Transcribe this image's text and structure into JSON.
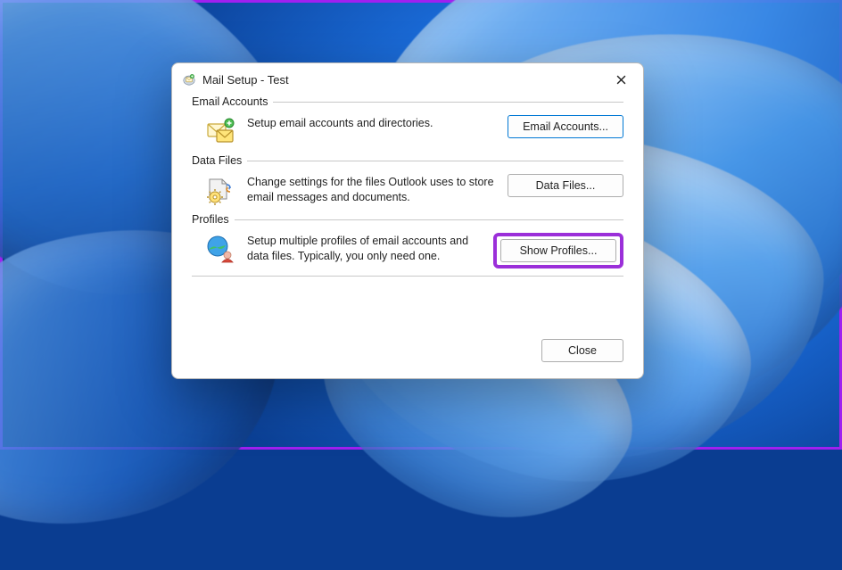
{
  "dialog": {
    "title": "Mail Setup - Test",
    "sections": {
      "email_accounts": {
        "legend": "Email Accounts",
        "description": "Setup email accounts and directories.",
        "button_label": "Email Accounts..."
      },
      "data_files": {
        "legend": "Data Files",
        "description": "Change settings for the files Outlook uses to store email messages and documents.",
        "button_label": "Data Files..."
      },
      "profiles": {
        "legend": "Profiles",
        "description": "Setup multiple profiles of email accounts and data files. Typically, you only need one.",
        "button_label": "Show Profiles..."
      }
    },
    "close_label": "Close"
  },
  "annotation": {
    "highlighted_button": "show-profiles-button",
    "highlight_color": "#9b2fd9"
  }
}
